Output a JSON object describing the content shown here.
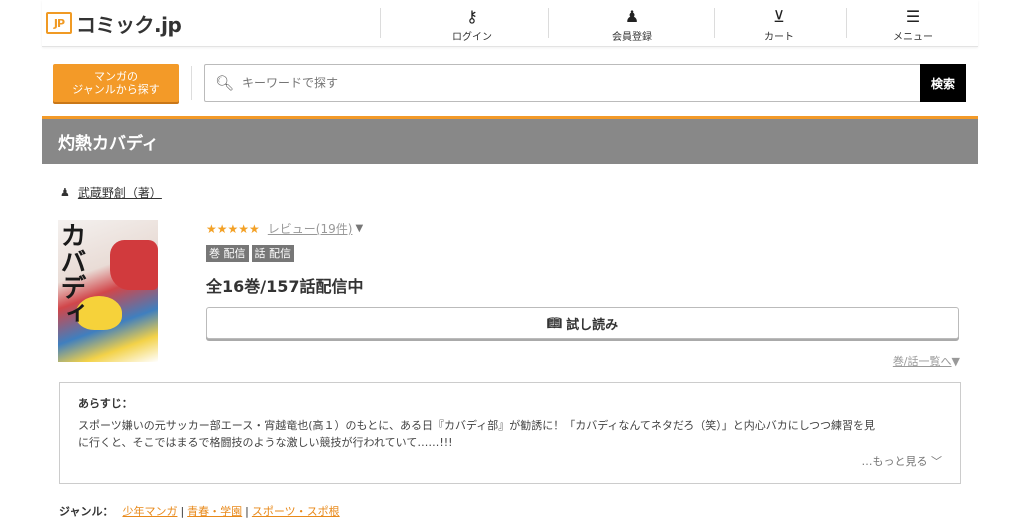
{
  "header": {
    "logo_mark": "JP",
    "logo_text": "コミック.jp",
    "nav": [
      {
        "label": "ログイン",
        "icon": "key-icon"
      },
      {
        "label": "会員登録",
        "icon": "person-icon"
      },
      {
        "label": "カート",
        "icon": "cart-icon"
      },
      {
        "label": "メニュー",
        "icon": "menu-icon"
      }
    ]
  },
  "search": {
    "genre_button_line1": "マンガの",
    "genre_button_line2": "ジャンルから探す",
    "placeholder": "キーワードで探す",
    "button_label": "検索"
  },
  "title": "灼熱カバディ",
  "author": "武蔵野創（著）",
  "rating": {
    "stars": "★★★★★",
    "review_link": "レビュー(19件)",
    "arrow": "▼"
  },
  "badges": [
    "巻 配信",
    "話 配信"
  ],
  "availability": "全16巻/157話配信中",
  "trial_button": "試し読み",
  "volume_link": "巻/話一覧へ",
  "volume_arrow": "▼",
  "synopsis": {
    "heading": "あらすじ：",
    "line1": "スポーツ嫌いの元サッカー部エース・宵越竜也(高１）のもとに、ある日『カバディ部』が勧誘に！「カバディなんてネタだろ（笑）」と内心バカにしつつ練習を見",
    "line2": "に行くと、そこではまるで格闘技のような激しい競技が行われていて……!!!",
    "more": "…もっと見る"
  },
  "genres": {
    "label": "ジャンル：",
    "items": [
      "少年マンガ",
      "青春・学園",
      "スポーツ・スポ根"
    ]
  },
  "colors": {
    "accent": "#f39a28",
    "title_bar": "#888888",
    "link_orange": "#e8891a",
    "star": "#f3a126"
  }
}
